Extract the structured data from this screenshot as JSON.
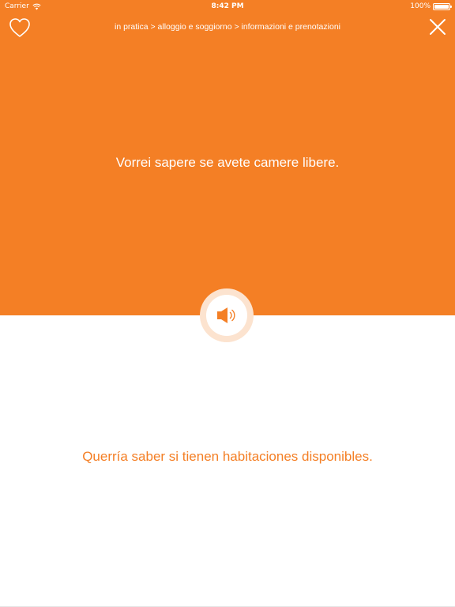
{
  "status_bar": {
    "carrier": "Carrier",
    "time": "8:42 PM",
    "battery": "100%"
  },
  "icons": {
    "favorite": "heart-outline-icon",
    "close": "close-x-icon",
    "audio": "speaker-icon",
    "wifi": "wifi-icon",
    "battery": "battery-icon"
  },
  "header": {
    "breadcrumb": "in pratica > alloggio e soggiorno > informazioni e prenotazioni"
  },
  "phrase": {
    "source": "Vorrei sapere se avete camere libere.",
    "translation": "Querría saber si tienen habitaciones disponibles."
  },
  "colors": {
    "accent": "#f47f25",
    "background": "#ffffff",
    "ring": "#fce3cf"
  }
}
